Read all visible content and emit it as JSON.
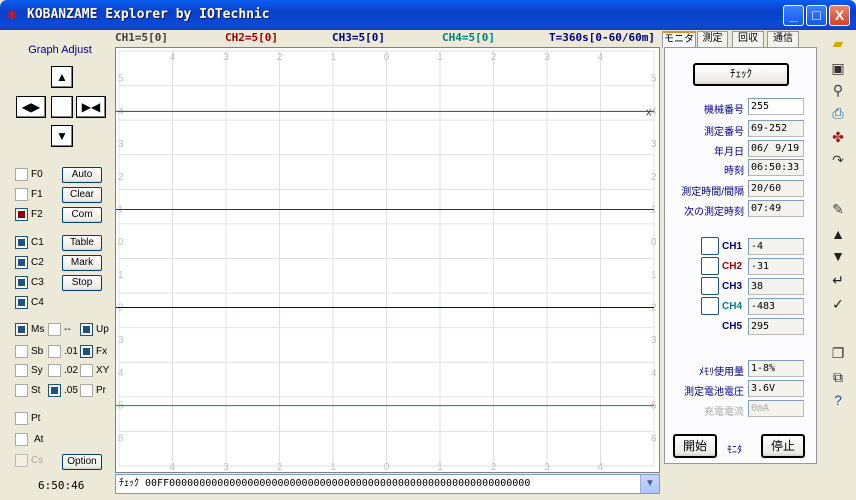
{
  "window": {
    "title": "KOBANZAME Explorer by IOTechnic",
    "minimize": "_",
    "maximize": "□",
    "close": "X"
  },
  "left": {
    "graph_adjust": "Graph Adjust",
    "f0": "F0",
    "f1": "F1",
    "f2": "F2",
    "auto": "Auto",
    "clear": "Clear",
    "com": "Com",
    "c1": "C1",
    "c2": "C2",
    "c3": "C3",
    "c4": "C4",
    "table": "Table",
    "mark": "Mark",
    "stop": "Stop",
    "ms": "Ms",
    "dash": "--",
    "up": "Up",
    "sb": "Sb",
    "p01": ".01",
    "fx": "Fx",
    "sy": "Sy",
    "p02": ".02",
    "xy": "XY",
    "st": "St",
    "p05": ".05",
    "pr": "Pr",
    "pt": "Pt",
    "at": "At",
    "cs": "Cs",
    "option": "Option",
    "time": "6:50:46"
  },
  "header": {
    "ch1": "CH1=5[0]",
    "ch2": "CH2=5[0]",
    "ch3": "CH3=5[0]",
    "ch4": "CH4=5[0]",
    "t": "T=360s[0-60/60m]"
  },
  "tabs": [
    "モニタ",
    "測定",
    "回収",
    "通信"
  ],
  "chart_data": {
    "type": "line",
    "x_ticks_top": [
      "4",
      "3",
      "2",
      "1",
      "0",
      "1",
      "2",
      "3",
      "4"
    ],
    "x_ticks_bottom": [
      "4",
      "3",
      "2",
      "1",
      "0",
      "1",
      "2",
      "3",
      "4"
    ],
    "y_ticks": [
      "5",
      "4",
      "3",
      "2",
      "1",
      "0",
      "1",
      "2",
      "3",
      "4",
      "5",
      "6"
    ],
    "end_marker": "x",
    "series": [
      {
        "color": "#404040",
        "y": -4
      },
      {
        "color": "#a00000",
        "y": -1
      },
      {
        "color": "#000080",
        "y": 2
      },
      {
        "color": "#008080",
        "y": 5
      }
    ]
  },
  "status": {
    "text": "ﾁｪｯｸ 00FF000000000000000000000000000000000000000000000000000000000000"
  },
  "monitor": {
    "check_button": "ﾁｪｯｸ",
    "rows": [
      {
        "label": "機械番号",
        "value": "255"
      },
      {
        "label": "測定番号",
        "value": "69-252"
      },
      {
        "label": "年月日",
        "value": "06/ 9/19"
      },
      {
        "label": "時刻",
        "value": "06:50:33"
      },
      {
        "label": "測定時間/間隔",
        "value": "20/60"
      },
      {
        "label": "次の測定時刻",
        "value": "07:49"
      }
    ],
    "channels": [
      {
        "label": "CH1",
        "value": "-4",
        "color": "#000080"
      },
      {
        "label": "CH2",
        "value": "-31",
        "color": "#a00000"
      },
      {
        "label": "CH3",
        "value": "38",
        "color": "#000080"
      },
      {
        "label": "CH4",
        "value": "-483",
        "color": "#008080"
      },
      {
        "label": "CH5",
        "value": "295",
        "color": "#000080"
      }
    ],
    "memory_label": "ﾒﾓﾘ使用量",
    "memory_value": "1-8%",
    "battery_label": "測定電池電圧",
    "battery_value": "3.6V",
    "charge_label": "充電電流",
    "charge_value": "0mA",
    "start": "開始",
    "mode": "ﾓﾆﾀ",
    "stop": "停止"
  },
  "colors": {
    "ch1": "#404040",
    "ch2": "#a00000",
    "ch3": "#000080",
    "ch4": "#008080"
  }
}
